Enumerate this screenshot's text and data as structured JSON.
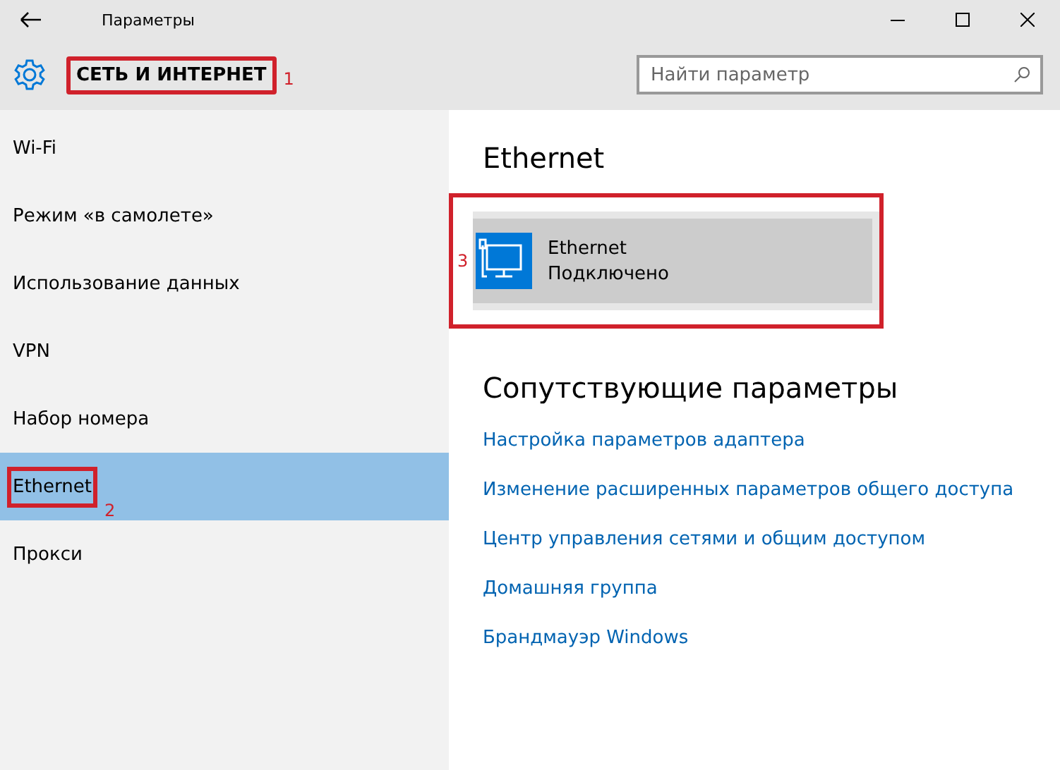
{
  "window": {
    "title": "Параметры"
  },
  "header": {
    "title": "СЕТЬ И ИНТЕРНЕТ",
    "annotation": "1"
  },
  "search": {
    "placeholder": "Найти параметр"
  },
  "sidebar": {
    "items": [
      {
        "label": "Wi-Fi",
        "selected": false
      },
      {
        "label": "Режим «в самолете»",
        "selected": false
      },
      {
        "label": "Использование данных",
        "selected": false
      },
      {
        "label": "VPN",
        "selected": false
      },
      {
        "label": "Набор номера",
        "selected": false
      },
      {
        "label": "Ethernet",
        "selected": true,
        "annotation": "2"
      },
      {
        "label": "Прокси",
        "selected": false
      }
    ]
  },
  "content": {
    "title": "Ethernet",
    "connection": {
      "name": "Ethernet",
      "status": "Подключено",
      "annotation": "3"
    },
    "related_title": "Сопутствующие параметры",
    "links": [
      "Настройка параметров адаптера",
      "Изменение расширенных параметров общего доступа",
      "Центр управления сетями и общим доступом",
      "Домашняя группа",
      "Брандмауэр Windows"
    ]
  }
}
